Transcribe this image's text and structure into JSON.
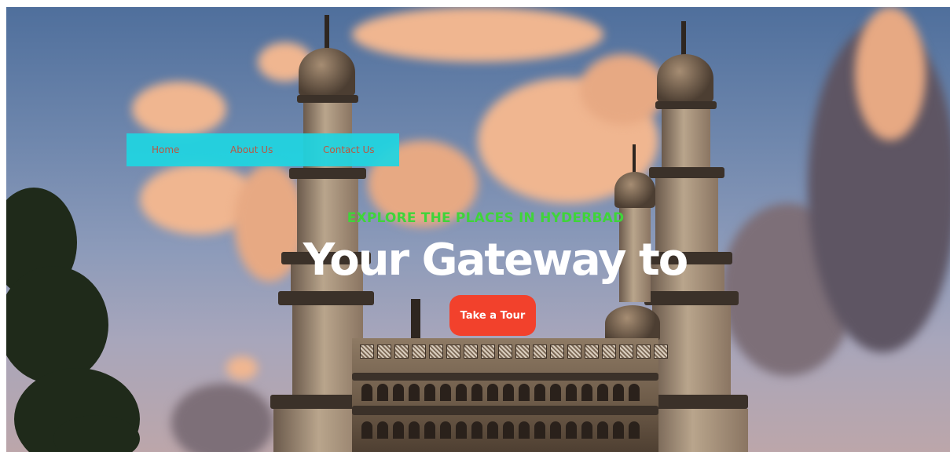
{
  "nav": {
    "items": [
      {
        "label": "Home"
      },
      {
        "label": "About Us"
      },
      {
        "label": "Contact Us"
      }
    ],
    "background_color": "#1fd6e2",
    "link_color": "#c0533a"
  },
  "hero": {
    "subtitle": "EXPLORE THE PLACES IN HYDERBAD",
    "subtitle_color": "#3fd43a",
    "title": "Your Gateway to",
    "title_color": "#ffffff",
    "cta_label": "Take a Tour",
    "cta_color": "#f2412c"
  }
}
